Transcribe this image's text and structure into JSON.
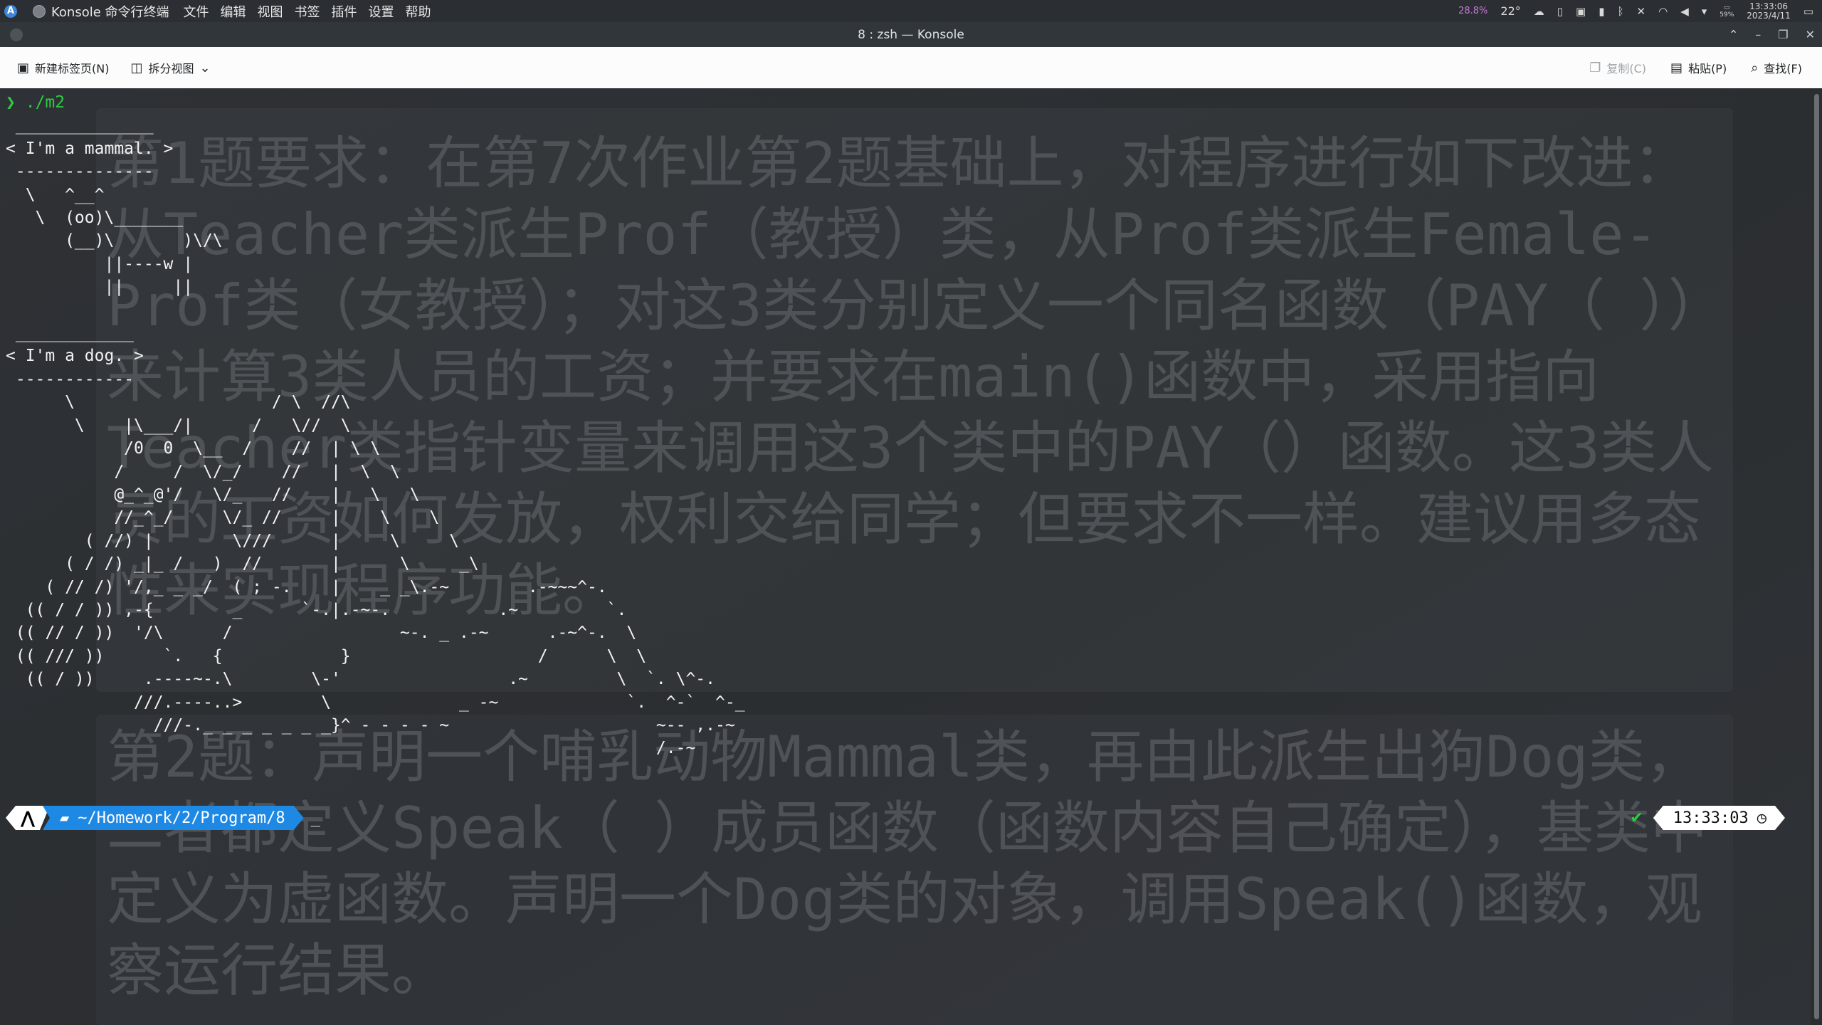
{
  "topbar": {
    "launcher_icon": "A",
    "app_name": "Konsole 命令行终端",
    "menu": [
      "文件",
      "编辑",
      "视图",
      "书签",
      "插件",
      "设置",
      "帮助"
    ],
    "tray": {
      "weather_percent": "28.8%",
      "temperature": "22°",
      "battery_percent": "59%",
      "time": "13:33:06",
      "date": "2023/4/11"
    }
  },
  "titlebar": {
    "title": "8 : zsh — Konsole"
  },
  "toolbar": {
    "new_tab": "新建标签页(N)",
    "split_view": "拆分视图",
    "copy": "复制(C)",
    "paste": "粘贴(P)",
    "find": "查找(F)"
  },
  "terminal": {
    "command": "./m2",
    "output": " ______________\n< I'm a mammal. >\n --------------\n  \\   ^__^\n   \\  (oo)\\_______\n      (__)\\       )\\/\\\n          ||----w |\n          ||     ||\n\n ____________\n< I'm a dog. >\n ------------\n      \\                    / \\  //\\\n       \\    |\\___/|      /   \\//  \\\n            /0  0  \\__  /    //  | \\ \\\n           /     /  \\/_/    //   |  \\  \\\n           @_^_@'/   \\/_   //    |   \\   \\\n           //_^_/     \\/_ //     |    \\    \\\n        ( //) |        \\///      |     \\     \\\n      ( / /) _|_ /   )  //       |      \\     _\\\n    ( // /) '/,_ _ _/  ( ; -.    |    _ _\\.-~        .-~~~^-.\n  (( / / )) ,-{        _      `-.|.-~-.           .~         `.\n (( // / ))  '/\\      /                 ~-. _ .-~      .-~^-.  \\\n (( /// ))      `.   {            }                   /      \\  \\\n  (( / ))     .----~-.\\        \\-'                 .~         \\  `. \\^-.\n             ///.----..>        \\             _ -~             `.  ^-`  ^-_\n               ///-._ _ _ _ _ _ _}^ - - - - ~                     ~-- ,.-~\n                                                                  /.-~",
    "prompt_path": "~/Homework/2/Program/8",
    "prompt_time": "13:33:03",
    "watermark_1": "第1题要求：在第7次作业第2题基础上，对程序进行如下改进：从Teacher类派生Prof（教授）类，从Prof类派生Female-Prof类（女教授）；对这3类分别定义一个同名函数（PAY（ ））来计算3类人员的工资；并要求在main()函数中，采用指向Teacher类指针变量来调用这3个类中的PAY（）函数。这3类人员的工资如何发放，权利交给同学；但要求不一样。建议用多态性来实现程序功能。",
    "watermark_2": "第2题：声明一个哺乳动物Mammal类，再由此派生出狗Dog类，二者都定义Speak（ ）成员函数（函数内容自己确定），基类中定义为虚函数。声明一个Dog类的对象，调用Speak()函数，观察运行结果。"
  },
  "colors": {
    "prompt_green": "#2ecc40",
    "dir_segment_blue": "#1e88e5",
    "terminal_bg": "#2b2d30"
  }
}
